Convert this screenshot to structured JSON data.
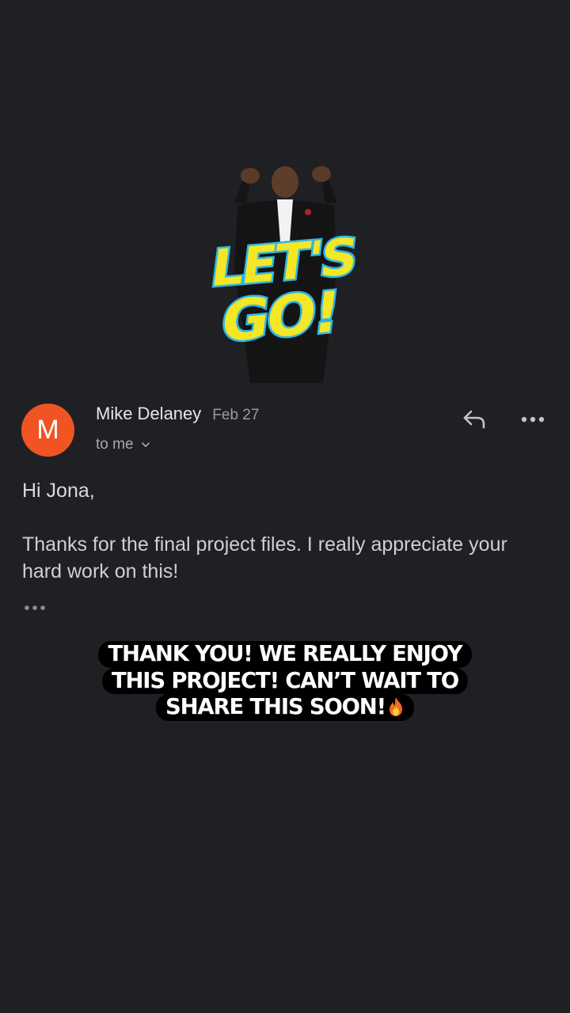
{
  "sticker": {
    "text_line1": "LET'S",
    "text_line2": "GO!",
    "icon": "lets-go-sticker"
  },
  "email": {
    "avatar_initial": "M",
    "avatar_color": "#f05423",
    "sender": "Mike Delaney",
    "date": "Feb 27",
    "recipient": "to me",
    "reply_icon": "reply-icon",
    "more_icon": "more-horizontal-icon",
    "greeting": "Hi Jona,",
    "body": "Thanks for the final project files. I really appreciate your hard work on this!",
    "trimmed_icon": "show-trimmed-content-icon"
  },
  "caption": {
    "line1": "THANK YOU! WE REALLY ENJOY",
    "line2": "THIS PROJECT! CAN’T WAIT TO",
    "line3": "SHARE THIS SOON!",
    "emoji": "fire-icon"
  },
  "colors": {
    "background": "#1f2024",
    "caption_bg": "#000000",
    "sticker_yellow": "#f4e726",
    "sticker_cyan": "#2fb7e6"
  }
}
